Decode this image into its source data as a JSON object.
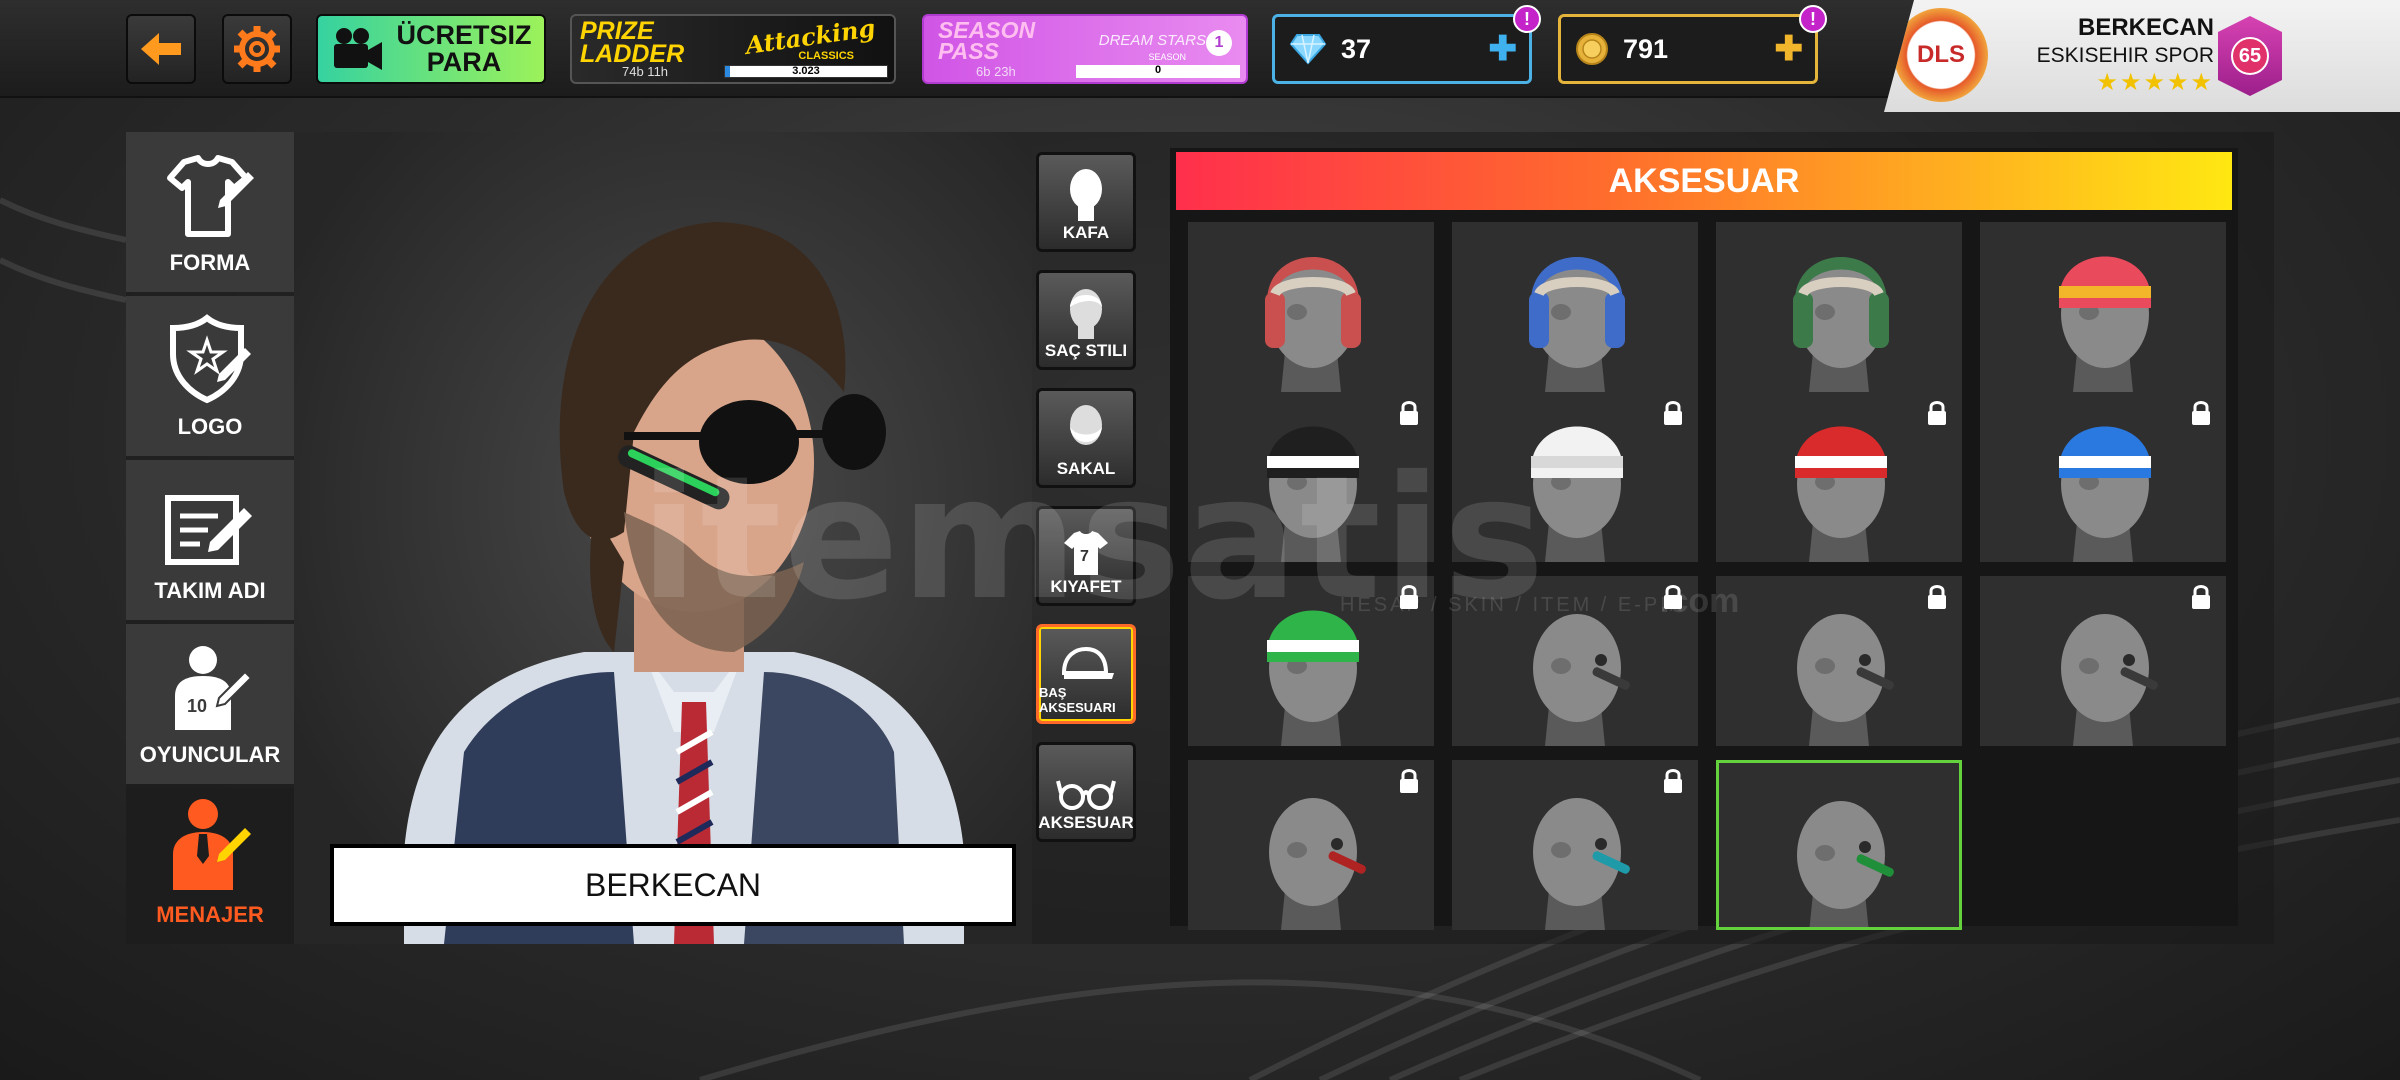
{
  "topbar": {
    "free_money": "ÜCRETSIZ\nPARA",
    "prize_ladder": {
      "title": "PRIZE\nLADDER",
      "brand": "Attacking",
      "brand_sub": "CLASSICS",
      "time": "74b 11h",
      "value": "3.023",
      "progress": 0.03
    },
    "season_pass": {
      "title": "SEASON\nPASS",
      "sub": "DREAM STARS",
      "sub2": "SEASON",
      "time": "6b 23h",
      "value": "0"
    },
    "gems": "37",
    "coins": "791",
    "alert": "!"
  },
  "profile": {
    "badge_text": "DLS",
    "name": "BERKECAN",
    "team": "ESKISEHIR SPOR",
    "stars": "★★★★★",
    "level": "65"
  },
  "sidebar": [
    {
      "label": "FORMA",
      "icon": "shirt-edit-icon",
      "active": false
    },
    {
      "label": "LOGO",
      "icon": "shield-edit-icon",
      "active": false
    },
    {
      "label": "TAKIM ADI",
      "icon": "note-edit-icon",
      "active": false
    },
    {
      "label": "OYUNCULAR",
      "icon": "player-edit-icon",
      "active": false
    },
    {
      "label": "MENAJER",
      "icon": "manager-edit-icon",
      "active": true
    }
  ],
  "manager_name": "BERKECAN",
  "categories": [
    {
      "label": "KAFA",
      "icon": "head-icon"
    },
    {
      "label": "SAÇ STILI",
      "icon": "hairstyle-icon"
    },
    {
      "label": "SAKAL",
      "icon": "beard-icon"
    },
    {
      "label": "KIYAFET",
      "icon": "shirt-icon"
    },
    {
      "label": "BAŞ AKSESUARI",
      "icon": "cap-icon"
    },
    {
      "label": "AKSESUAR",
      "icon": "glasses-icon"
    }
  ],
  "active_category": "BAŞ AKSESUARI",
  "grid_title": "AKSESUAR",
  "items": [
    {
      "type": "trapper",
      "color": "#c9504f",
      "locked": false
    },
    {
      "type": "trapper",
      "color": "#3f6cc9",
      "locked": false
    },
    {
      "type": "trapper",
      "color": "#3c7a4a",
      "locked": false
    },
    {
      "type": "beanie",
      "color": "#e94a5c",
      "stripe": "#f3b62a",
      "locked": false
    },
    {
      "type": "beanie",
      "color": "#1f1f1f",
      "stripe": "#ffffff",
      "locked": true
    },
    {
      "type": "beanie",
      "color": "#f2f2f2",
      "stripe": "#d8d8d8",
      "locked": true
    },
    {
      "type": "beanie",
      "color": "#d92b2b",
      "stripe": "#ffffff",
      "locked": true
    },
    {
      "type": "beanie",
      "color": "#2a79e0",
      "stripe": "#ffffff",
      "locked": true
    },
    {
      "type": "beanie",
      "color": "#2fb44a",
      "stripe": "#ffffff",
      "locked": true
    },
    {
      "type": "headset",
      "color": "#3a3a3a",
      "locked": true
    },
    {
      "type": "headset",
      "color": "#3a3a3a",
      "locked": true
    },
    {
      "type": "headset",
      "color": "#3a3a3a",
      "locked": true
    },
    {
      "type": "headset",
      "color": "#b02323",
      "locked": true
    },
    {
      "type": "headset",
      "color": "#1e9aa8",
      "locked": true
    },
    {
      "type": "headset",
      "color": "#1f8f3a",
      "locked": false,
      "selected": true
    }
  ],
  "watermark": "itemsatis",
  "watermark_sub": "HESAP / SKIN / ITEM / E-PIN",
  "watermark_com": ".com"
}
